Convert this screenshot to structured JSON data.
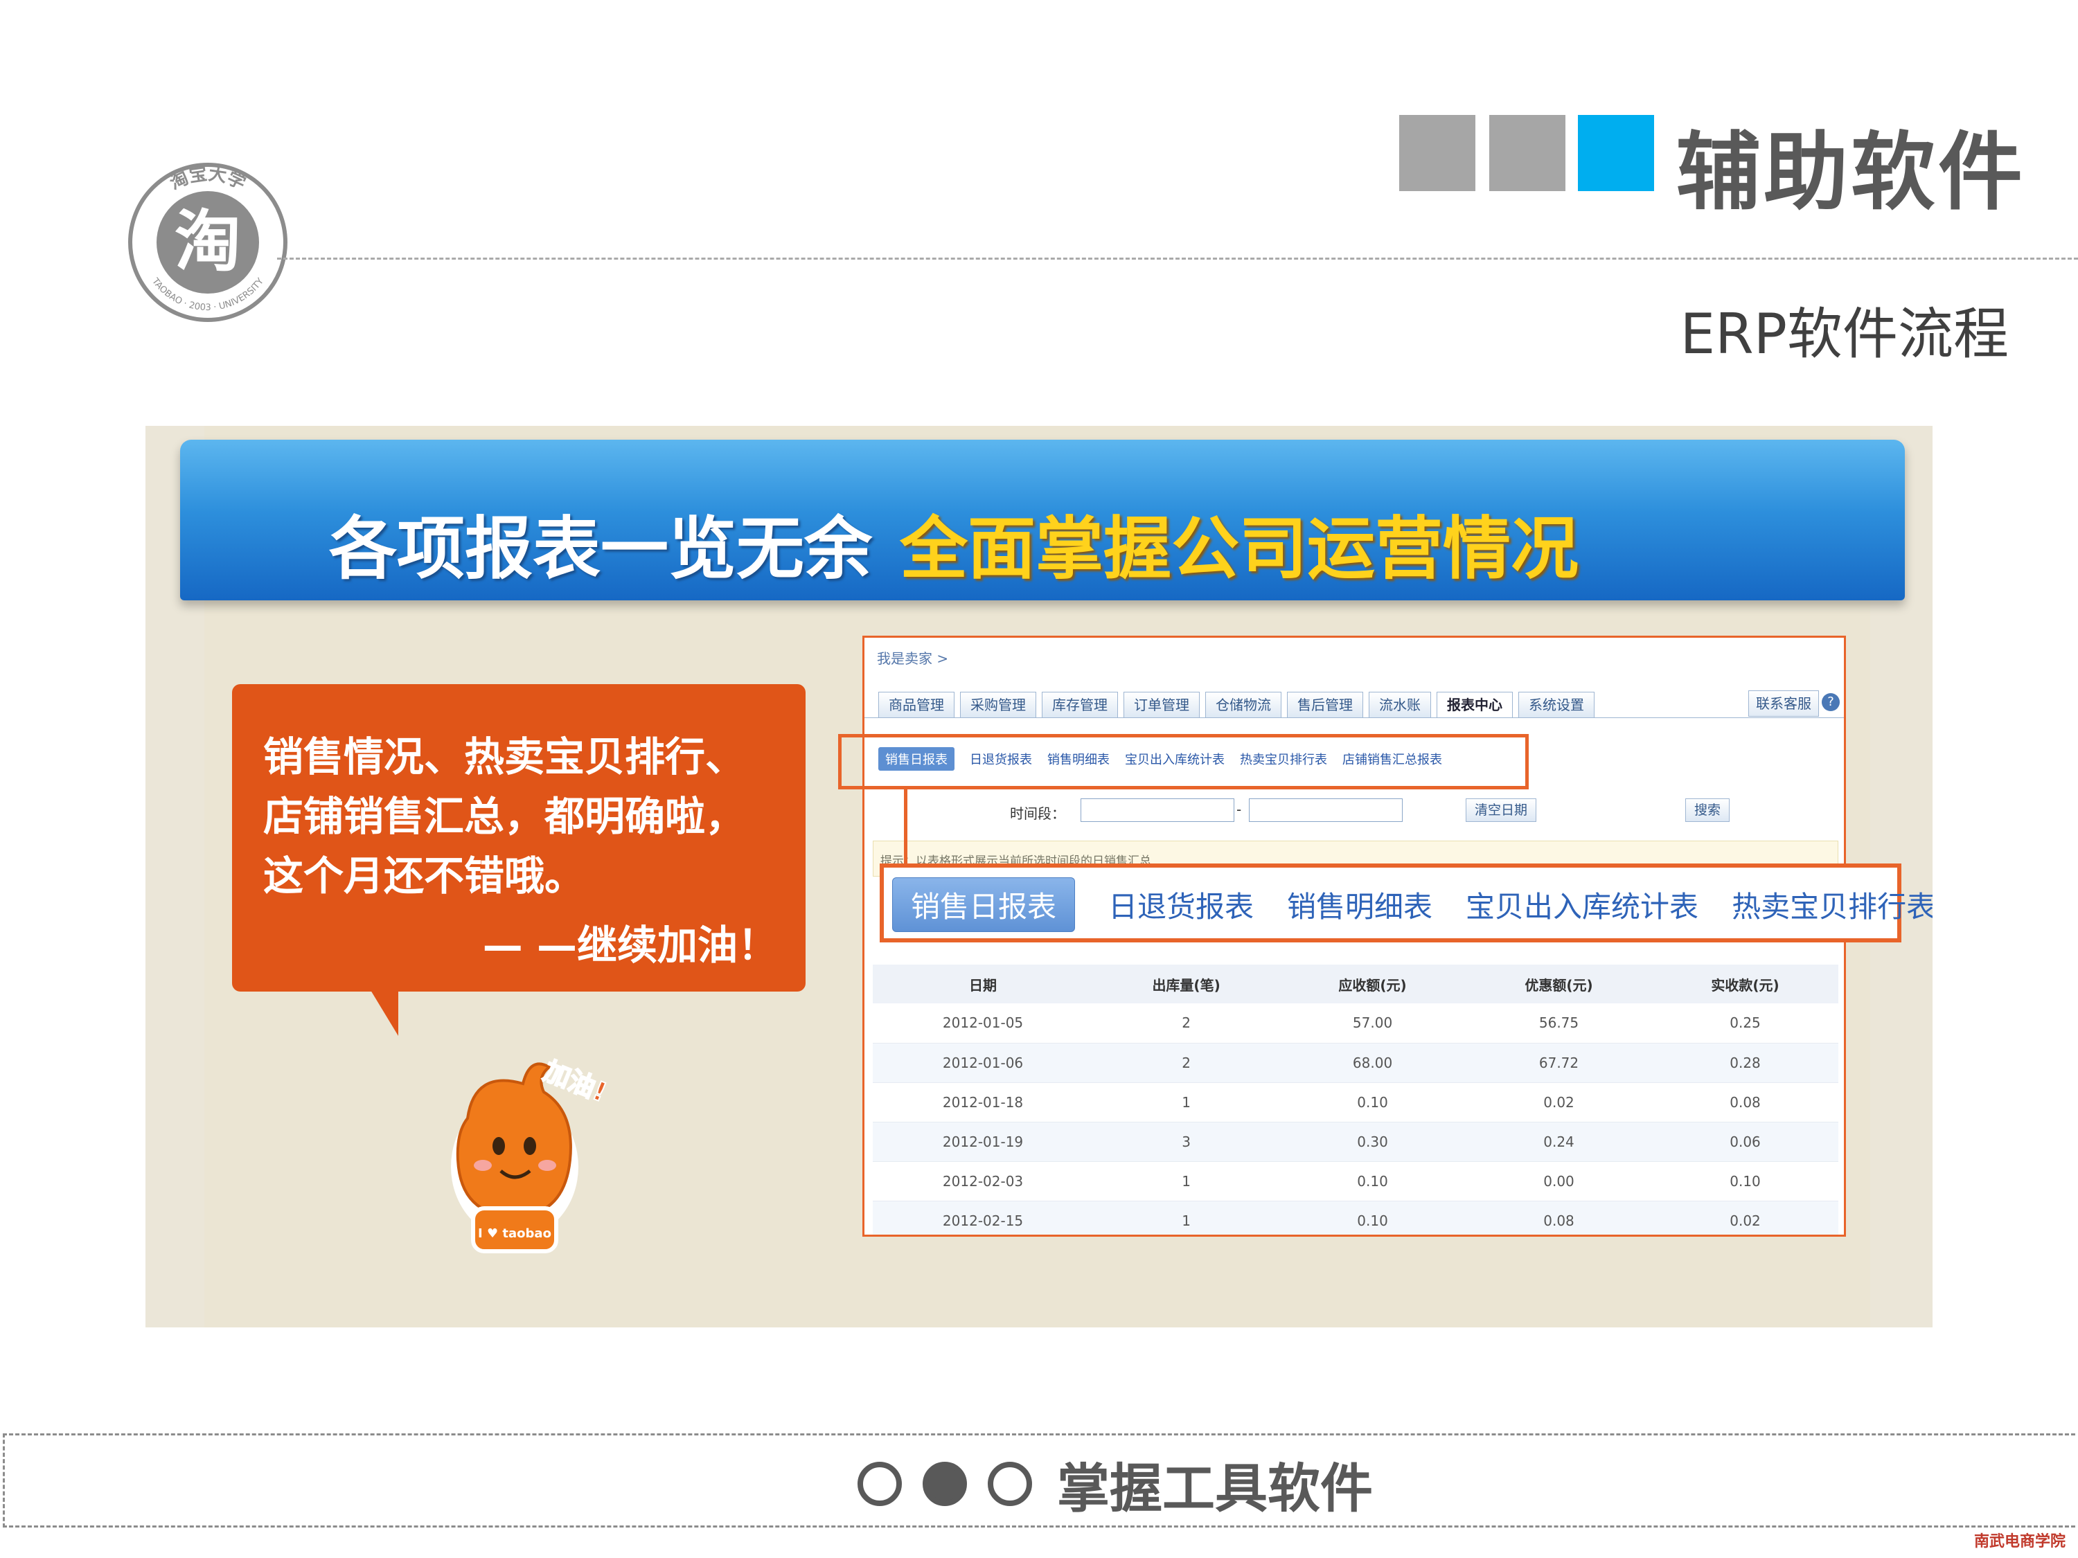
{
  "header": {
    "title": "辅助软件",
    "subtitle": "ERP软件流程",
    "logo": {
      "char": "淘",
      "top_text": "淘宝大学",
      "bottom_text": "TAOBAO · 2003 · UNIVERSITY"
    }
  },
  "banner": {
    "white_text": "各项报表一览无余",
    "yellow_text": "全面掌握公司运营情况"
  },
  "bubble": {
    "line1": "销售情况、热卖宝贝排行、",
    "line2": "店铺销售汇总，都明确啦，",
    "line3": "这个月还不错哦。",
    "signature": "— —继续加油！"
  },
  "mascot": {
    "sign": "加油!",
    "shirt": "I ♥ taobao"
  },
  "erp": {
    "breadcrumb": "我是卖家 >",
    "tabs": [
      "商品管理",
      "采购管理",
      "库存管理",
      "订单管理",
      "仓储物流",
      "售后管理",
      "流水账",
      "报表中心",
      "系统设置"
    ],
    "active_tab": "报表中心",
    "contact_button": "联系客服",
    "help_icon": "?",
    "subtabs": [
      "销售日报表",
      "日退货报表",
      "销售明细表",
      "宝贝出入库统计表",
      "热卖宝贝排行表",
      "店铺销售汇总报表"
    ],
    "active_subtab": "销售日报表",
    "time_label": "时间段：",
    "date_separator": "-",
    "clear_button": "清空日期",
    "search_button": "搜索",
    "notice": "提示：以表格形式展示当前所选时间段的日销售汇总",
    "table": {
      "columns": [
        "日期",
        "出库量(笔)",
        "应收额(元)",
        "优惠额(元)",
        "实收款(元)"
      ],
      "rows": [
        [
          "2012-01-05",
          "2",
          "57.00",
          "56.75",
          "0.25"
        ],
        [
          "2012-01-06",
          "2",
          "68.00",
          "67.72",
          "0.28"
        ],
        [
          "2012-01-18",
          "1",
          "0.10",
          "0.02",
          "0.08"
        ],
        [
          "2012-01-19",
          "3",
          "0.30",
          "0.24",
          "0.06"
        ],
        [
          "2012-02-03",
          "1",
          "0.10",
          "0.00",
          "0.10"
        ],
        [
          "2012-02-15",
          "1",
          "0.10",
          "0.08",
          "0.02"
        ]
      ]
    }
  },
  "zoom_tabs": {
    "items": [
      "销售日报表",
      "日退货报表",
      "销售明细表",
      "宝贝出入库统计表",
      "热卖宝贝排行表"
    ]
  },
  "footer": {
    "text": "掌握工具软件",
    "corner_logo": "南武电商学院"
  },
  "colors": {
    "accent_blue": "#00aeef",
    "gray": "#a6a6a6",
    "highlight_orange": "#e8642a",
    "bubble_orange": "#e05518",
    "banner_yellow": "#ffd21c"
  }
}
